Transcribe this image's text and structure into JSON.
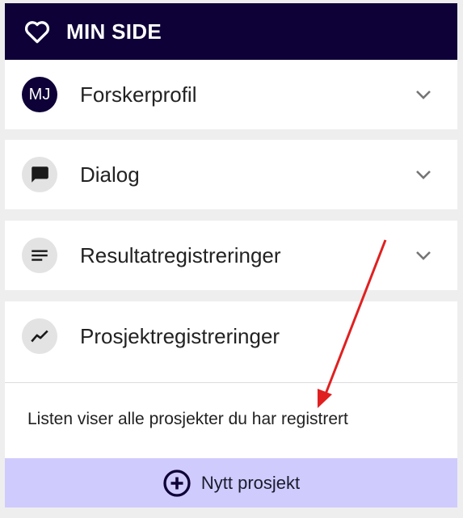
{
  "header": {
    "title": "MIN SIDE",
    "icon": "heart-icon",
    "background": "#0e0137"
  },
  "sections": [
    {
      "label": "Forskerprofil",
      "avatar_text": "MJ",
      "icon": "avatar-initials",
      "expanded": false
    },
    {
      "label": "Dialog",
      "icon": "chat-bubble-icon",
      "expanded": false
    },
    {
      "label": "Resultatregistreringer",
      "icon": "lines-icon",
      "expanded": false
    },
    {
      "label": "Prosjektregistreringer",
      "icon": "trending-icon",
      "expanded": true
    }
  ],
  "projects": {
    "description": "Listen viser alle prosjekter du har registrert",
    "new_button_label": "Nytt prosjekt",
    "new_button_icon": "plus-circle-icon",
    "button_color": "#cfcbfd"
  },
  "annotation": {
    "arrow_color": "#e02020"
  }
}
